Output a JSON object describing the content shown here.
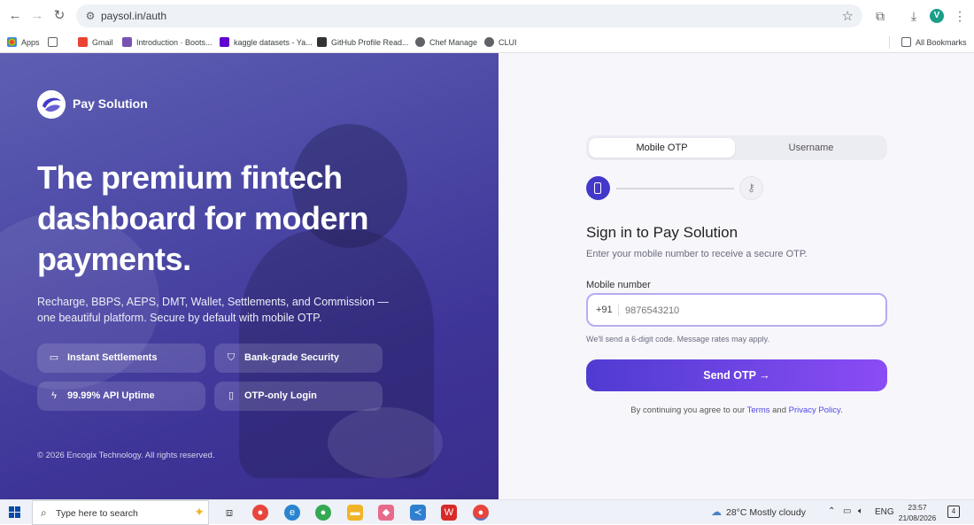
{
  "browser": {
    "url": "paysol.in/auth",
    "avatar_letter": "V",
    "bookmarks": [
      {
        "label": "Apps",
        "icon": "apps-grid-icon",
        "color": "#ea4335"
      },
      {
        "label": "",
        "icon": "grid-icon",
        "color": "#5f6368"
      },
      {
        "label": "Gmail",
        "icon": "gmail-icon",
        "color": "#ea4335"
      },
      {
        "label": "Introduction · Boots...",
        "icon": "bootstrap-icon",
        "color": "#7952b3"
      },
      {
        "label": "kaggle datasets - Ya...",
        "icon": "yahoo-icon",
        "color": "#6001d2"
      },
      {
        "label": "GitHub Profile Read...",
        "icon": "github-icon",
        "color": "#333333"
      },
      {
        "label": "Chef Manage",
        "icon": "globe-icon",
        "color": "#5f6368"
      },
      {
        "label": "CLUI",
        "icon": "globe-icon",
        "color": "#5f6368"
      }
    ],
    "all_bookmarks_label": "All Bookmarks"
  },
  "hero": {
    "brand_name": "Pay Solution",
    "headline": "The premium fintech dashboard for modern payments.",
    "subcopy": "Recharge, BBPS, AEPS, DMT, Wallet, Settlements, and Commission — one beautiful platform. Secure by default with mobile OTP.",
    "features": [
      {
        "label": "Instant Settlements",
        "icon": "wallet-icon"
      },
      {
        "label": "Bank-grade Security",
        "icon": "shield-icon"
      },
      {
        "label": "99.99% API Uptime",
        "icon": "lightning-icon"
      },
      {
        "label": "OTP-only Login",
        "icon": "phone-icon"
      }
    ],
    "copyright": "© 2026 Encogix Technology. All rights reserved."
  },
  "auth": {
    "tabs": [
      "Mobile OTP",
      "Username"
    ],
    "active_tab": "Mobile OTP",
    "title": "Sign in to Pay Solution",
    "subtitle": "Enter your mobile number to receive a secure OTP.",
    "mobile_label": "Mobile number",
    "country_code": "+91",
    "mobile_placeholder": "9876543210",
    "mobile_value": "",
    "hint": "We'll send a 6-digit code. Message rates may apply.",
    "send_button": "Send OTP",
    "terms_prefix": "By continuing you agree to our",
    "terms_link": "Terms",
    "terms_and": "and",
    "privacy_link": "Privacy Policy",
    "terms_suffix": "."
  },
  "taskbar": {
    "search_placeholder": "Type here to search",
    "weather": "28°C  Mostly cloudy",
    "weather_badge": "1",
    "language": "ENG",
    "time": "23:57",
    "date": "21/08/2026",
    "notifications": "4"
  },
  "colors": {
    "accent": "#4338ca",
    "button_gradient_start": "#4f3bd1",
    "button_gradient_end": "#8b4cf5",
    "link": "#4f46e5"
  }
}
